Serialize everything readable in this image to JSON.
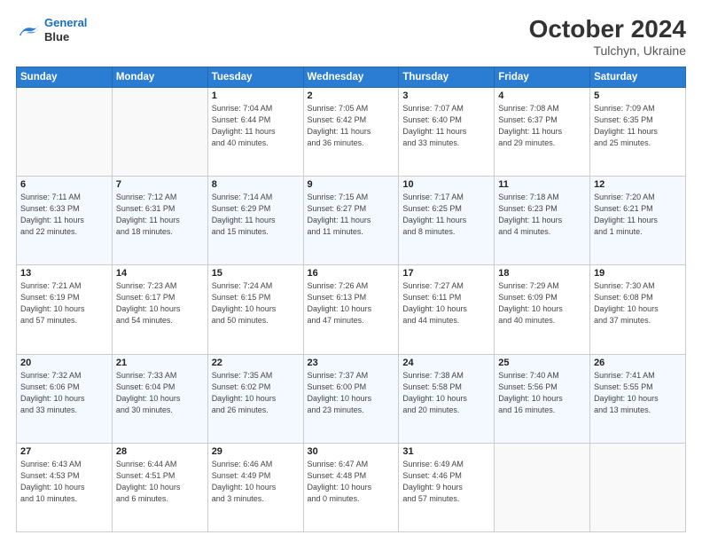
{
  "header": {
    "logo_line1": "General",
    "logo_line2": "Blue",
    "month": "October 2024",
    "location": "Tulchyn, Ukraine"
  },
  "weekdays": [
    "Sunday",
    "Monday",
    "Tuesday",
    "Wednesday",
    "Thursday",
    "Friday",
    "Saturday"
  ],
  "weeks": [
    [
      {
        "day": "",
        "info": ""
      },
      {
        "day": "",
        "info": ""
      },
      {
        "day": "1",
        "info": "Sunrise: 7:04 AM\nSunset: 6:44 PM\nDaylight: 11 hours\nand 40 minutes."
      },
      {
        "day": "2",
        "info": "Sunrise: 7:05 AM\nSunset: 6:42 PM\nDaylight: 11 hours\nand 36 minutes."
      },
      {
        "day": "3",
        "info": "Sunrise: 7:07 AM\nSunset: 6:40 PM\nDaylight: 11 hours\nand 33 minutes."
      },
      {
        "day": "4",
        "info": "Sunrise: 7:08 AM\nSunset: 6:37 PM\nDaylight: 11 hours\nand 29 minutes."
      },
      {
        "day": "5",
        "info": "Sunrise: 7:09 AM\nSunset: 6:35 PM\nDaylight: 11 hours\nand 25 minutes."
      }
    ],
    [
      {
        "day": "6",
        "info": "Sunrise: 7:11 AM\nSunset: 6:33 PM\nDaylight: 11 hours\nand 22 minutes."
      },
      {
        "day": "7",
        "info": "Sunrise: 7:12 AM\nSunset: 6:31 PM\nDaylight: 11 hours\nand 18 minutes."
      },
      {
        "day": "8",
        "info": "Sunrise: 7:14 AM\nSunset: 6:29 PM\nDaylight: 11 hours\nand 15 minutes."
      },
      {
        "day": "9",
        "info": "Sunrise: 7:15 AM\nSunset: 6:27 PM\nDaylight: 11 hours\nand 11 minutes."
      },
      {
        "day": "10",
        "info": "Sunrise: 7:17 AM\nSunset: 6:25 PM\nDaylight: 11 hours\nand 8 minutes."
      },
      {
        "day": "11",
        "info": "Sunrise: 7:18 AM\nSunset: 6:23 PM\nDaylight: 11 hours\nand 4 minutes."
      },
      {
        "day": "12",
        "info": "Sunrise: 7:20 AM\nSunset: 6:21 PM\nDaylight: 11 hours\nand 1 minute."
      }
    ],
    [
      {
        "day": "13",
        "info": "Sunrise: 7:21 AM\nSunset: 6:19 PM\nDaylight: 10 hours\nand 57 minutes."
      },
      {
        "day": "14",
        "info": "Sunrise: 7:23 AM\nSunset: 6:17 PM\nDaylight: 10 hours\nand 54 minutes."
      },
      {
        "day": "15",
        "info": "Sunrise: 7:24 AM\nSunset: 6:15 PM\nDaylight: 10 hours\nand 50 minutes."
      },
      {
        "day": "16",
        "info": "Sunrise: 7:26 AM\nSunset: 6:13 PM\nDaylight: 10 hours\nand 47 minutes."
      },
      {
        "day": "17",
        "info": "Sunrise: 7:27 AM\nSunset: 6:11 PM\nDaylight: 10 hours\nand 44 minutes."
      },
      {
        "day": "18",
        "info": "Sunrise: 7:29 AM\nSunset: 6:09 PM\nDaylight: 10 hours\nand 40 minutes."
      },
      {
        "day": "19",
        "info": "Sunrise: 7:30 AM\nSunset: 6:08 PM\nDaylight: 10 hours\nand 37 minutes."
      }
    ],
    [
      {
        "day": "20",
        "info": "Sunrise: 7:32 AM\nSunset: 6:06 PM\nDaylight: 10 hours\nand 33 minutes."
      },
      {
        "day": "21",
        "info": "Sunrise: 7:33 AM\nSunset: 6:04 PM\nDaylight: 10 hours\nand 30 minutes."
      },
      {
        "day": "22",
        "info": "Sunrise: 7:35 AM\nSunset: 6:02 PM\nDaylight: 10 hours\nand 26 minutes."
      },
      {
        "day": "23",
        "info": "Sunrise: 7:37 AM\nSunset: 6:00 PM\nDaylight: 10 hours\nand 23 minutes."
      },
      {
        "day": "24",
        "info": "Sunrise: 7:38 AM\nSunset: 5:58 PM\nDaylight: 10 hours\nand 20 minutes."
      },
      {
        "day": "25",
        "info": "Sunrise: 7:40 AM\nSunset: 5:56 PM\nDaylight: 10 hours\nand 16 minutes."
      },
      {
        "day": "26",
        "info": "Sunrise: 7:41 AM\nSunset: 5:55 PM\nDaylight: 10 hours\nand 13 minutes."
      }
    ],
    [
      {
        "day": "27",
        "info": "Sunrise: 6:43 AM\nSunset: 4:53 PM\nDaylight: 10 hours\nand 10 minutes."
      },
      {
        "day": "28",
        "info": "Sunrise: 6:44 AM\nSunset: 4:51 PM\nDaylight: 10 hours\nand 6 minutes."
      },
      {
        "day": "29",
        "info": "Sunrise: 6:46 AM\nSunset: 4:49 PM\nDaylight: 10 hours\nand 3 minutes."
      },
      {
        "day": "30",
        "info": "Sunrise: 6:47 AM\nSunset: 4:48 PM\nDaylight: 10 hours\nand 0 minutes."
      },
      {
        "day": "31",
        "info": "Sunrise: 6:49 AM\nSunset: 4:46 PM\nDaylight: 9 hours\nand 57 minutes."
      },
      {
        "day": "",
        "info": ""
      },
      {
        "day": "",
        "info": ""
      }
    ]
  ]
}
